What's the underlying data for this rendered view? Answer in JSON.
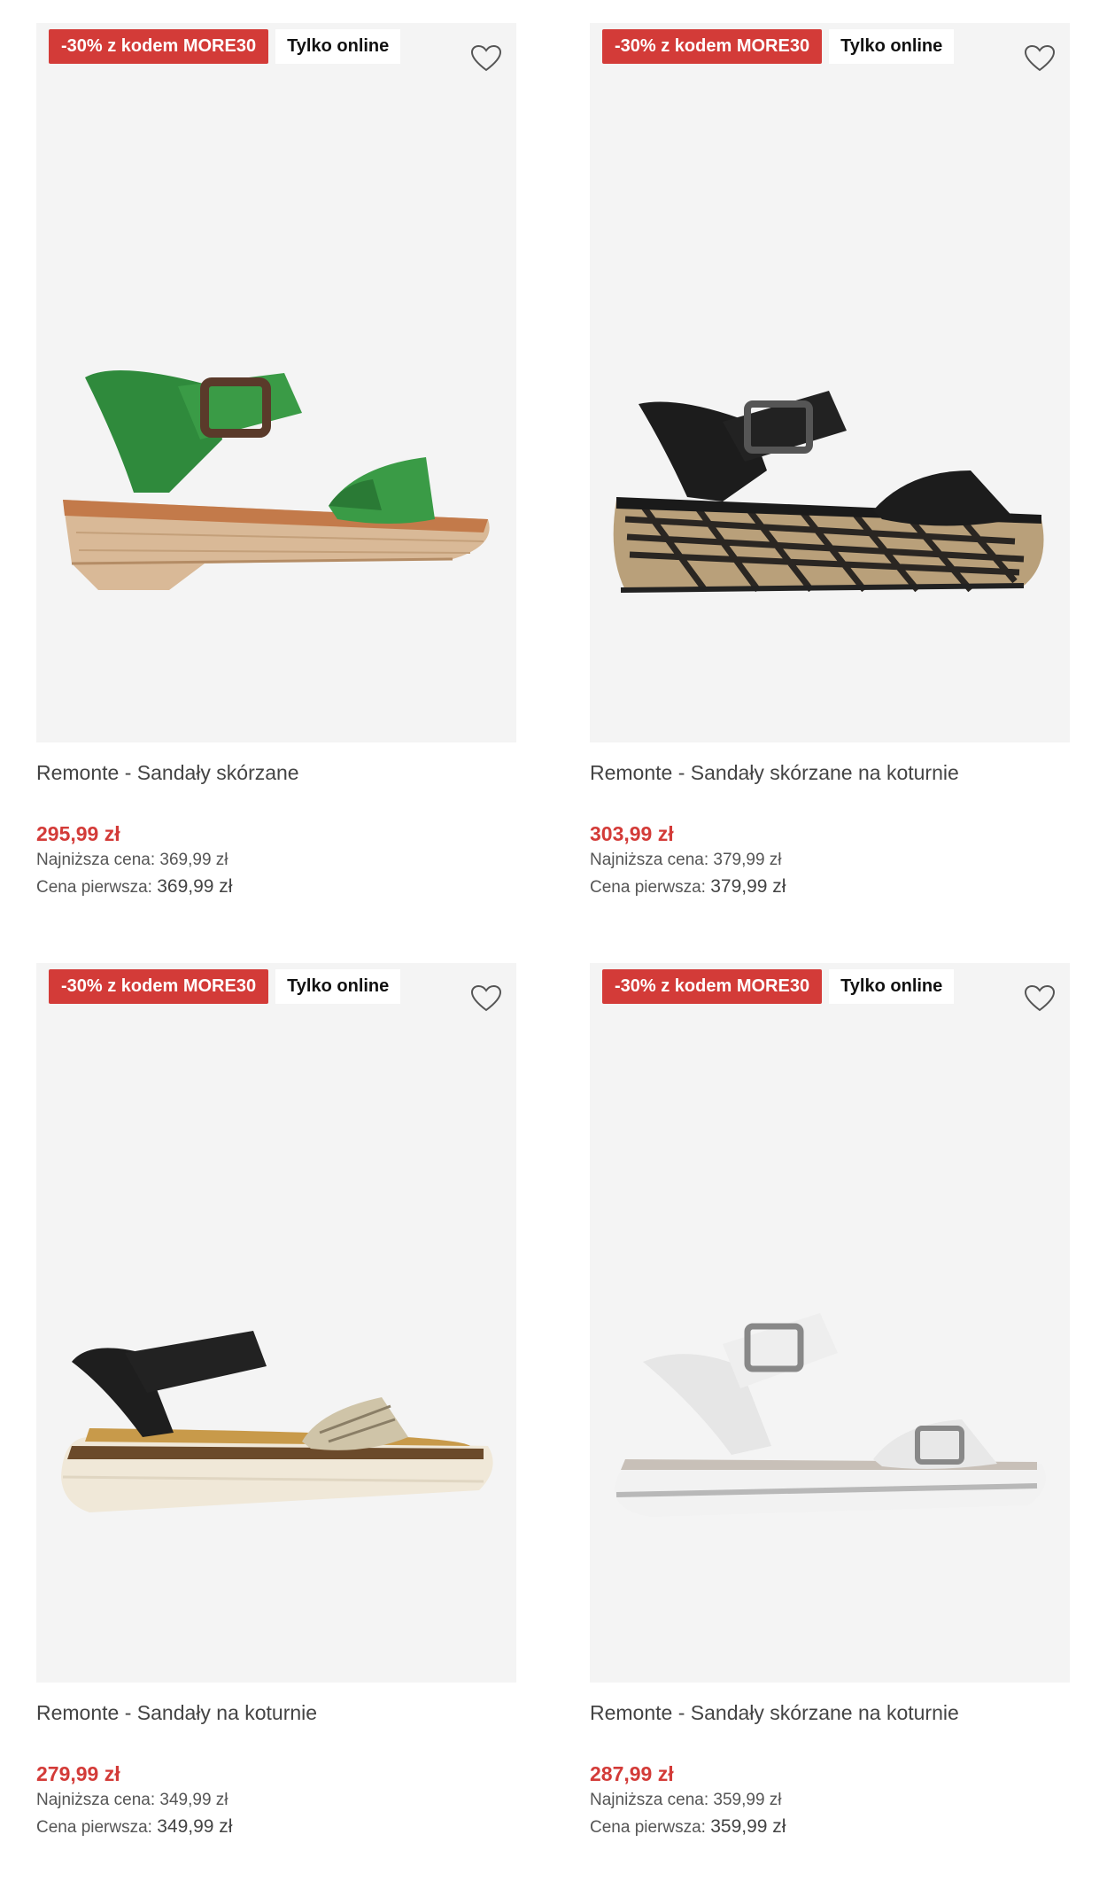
{
  "products": [
    {
      "promo_badge": "-30% z kodem MORE30",
      "online_badge": "Tylko online",
      "title": "Remonte - Sandały skórzane",
      "price": "295,99 zł",
      "lowest_label": "Najniższa cena:",
      "lowest_value": "369,99 zł",
      "first_label": "Cena pierwsza:",
      "first_value": "369,99 zł",
      "image": "green-leather-sandal-block-heel"
    },
    {
      "promo_badge": "-30% z kodem MORE30",
      "online_badge": "Tylko online",
      "title": "Remonte - Sandały skórzane na koturnie",
      "price": "303,99 zł",
      "lowest_label": "Najniższa cena:",
      "lowest_value": "379,99 zł",
      "first_label": "Cena pierwsza:",
      "first_value": "379,99 zł",
      "image": "black-suede-platform-sandal"
    },
    {
      "promo_badge": "-30% z kodem MORE30",
      "online_badge": "Tylko online",
      "title": "Remonte - Sandały na koturnie",
      "price": "279,99 zł",
      "lowest_label": "Najniższa cena:",
      "lowest_value": "349,99 zł",
      "first_label": "Cena pierwsza:",
      "first_value": "349,99 zł",
      "image": "black-beige-wedge-sandal"
    },
    {
      "promo_badge": "-30% z kodem MORE30",
      "online_badge": "Tylko online",
      "title": "Remonte - Sandały skórzane na koturnie",
      "price": "287,99 zł",
      "lowest_label": "Najniższa cena:",
      "lowest_value": "359,99 zł",
      "first_label": "Cena pierwsza:",
      "first_value": "359,99 zł",
      "image": "white-leather-platform-sandal"
    }
  ],
  "icons": {
    "favorite": "heart-outline-icon"
  },
  "colors": {
    "promo": "#d33b38",
    "price": "#d33b38",
    "image_bg": "#f4f4f4"
  }
}
